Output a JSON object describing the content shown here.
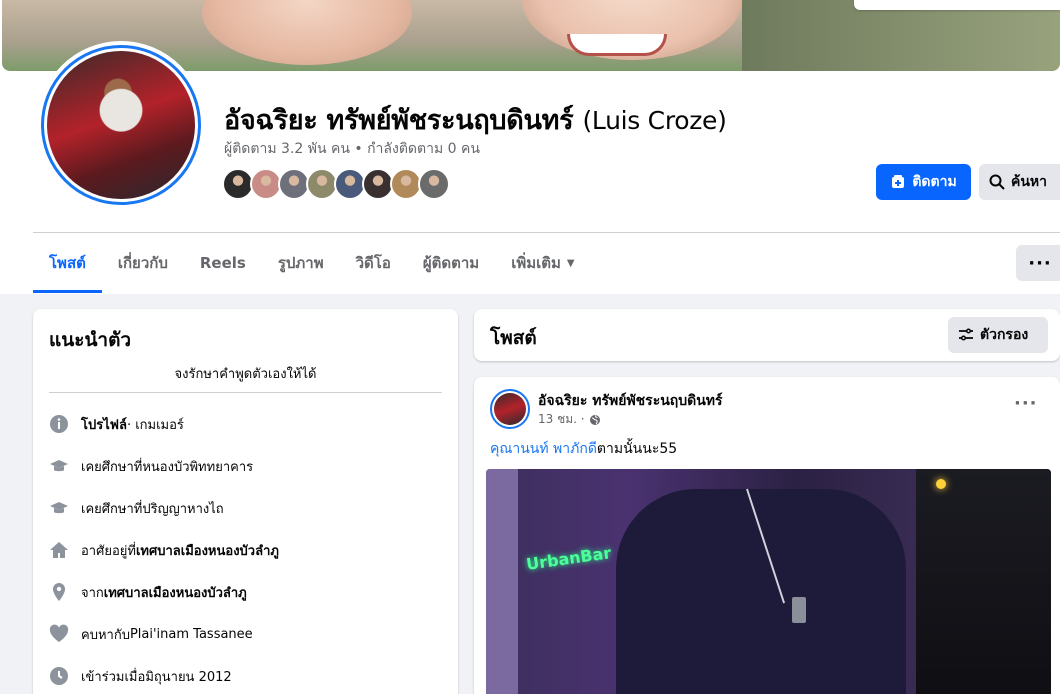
{
  "profile": {
    "name": "อัจฉริยะ ทรัพย์พัชระนฤบดินทร์",
    "alt_name": "(Luis Croze)",
    "followers_text": "ผู้ติดตาม 3.2 พัน คน • กำลังติดตาม 0 คน",
    "friend_avatar_colors": [
      "#2b2b2b",
      "#c98b85",
      "#6d6f7a",
      "#8c8a6b",
      "#4a5a7a",
      "#3b3030",
      "#b08a5a",
      "#6b6b6b"
    ]
  },
  "actions": {
    "follow_label": "ติดตาม",
    "search_label": "ค้นหา"
  },
  "tabs": [
    {
      "label": "โพสต์"
    },
    {
      "label": "เกี่ยวกับ"
    },
    {
      "label": "Reels"
    },
    {
      "label": "รูปภาพ"
    },
    {
      "label": "วิดีโอ"
    },
    {
      "label": "ผู้ติดตาม"
    },
    {
      "label": "เพิ่มเติม"
    }
  ],
  "intro": {
    "title": "แนะนำตัว",
    "bio": "จงรักษาคำพูดตัวเองให้ได้",
    "items": [
      {
        "icon": "info-icon",
        "bold": "โปรไฟล์",
        "text": " · เกมเมอร์"
      },
      {
        "icon": "education-icon",
        "prefix": "เคยศึกษาที่ ",
        "text": "หนองบัวพิททยาคาร"
      },
      {
        "icon": "education-icon",
        "prefix": "เคยศึกษาที่ ",
        "text": "ปริญญาหางไถ"
      },
      {
        "icon": "home-icon",
        "prefix": "อาศัยอยู่ที่ ",
        "bold": "เทศบาลเมืองหนองบัวลำภู"
      },
      {
        "icon": "location-icon",
        "prefix": "จาก ",
        "bold": "เทศบาลเมืองหนองบัวลำภู"
      },
      {
        "icon": "heart-icon",
        "prefix": "คบหากับ ",
        "text": "Plai'inam Tassanee"
      },
      {
        "icon": "clock-icon",
        "prefix": "เข้าร่วมเมื่อ ",
        "text": "มิถุนายน 2012"
      }
    ]
  },
  "posts": {
    "title": "โพสต์",
    "filter_label": "ตัวกรอง"
  },
  "post": {
    "author": "อัจฉริยะ ทรัพย์พัชระนฤบดินทร์",
    "time": "13 ชม. ·",
    "tag": "คุณานนท์ พาภักดี",
    "text": "ตามนั้นนะ55",
    "image_sign": "UrbanBar"
  }
}
